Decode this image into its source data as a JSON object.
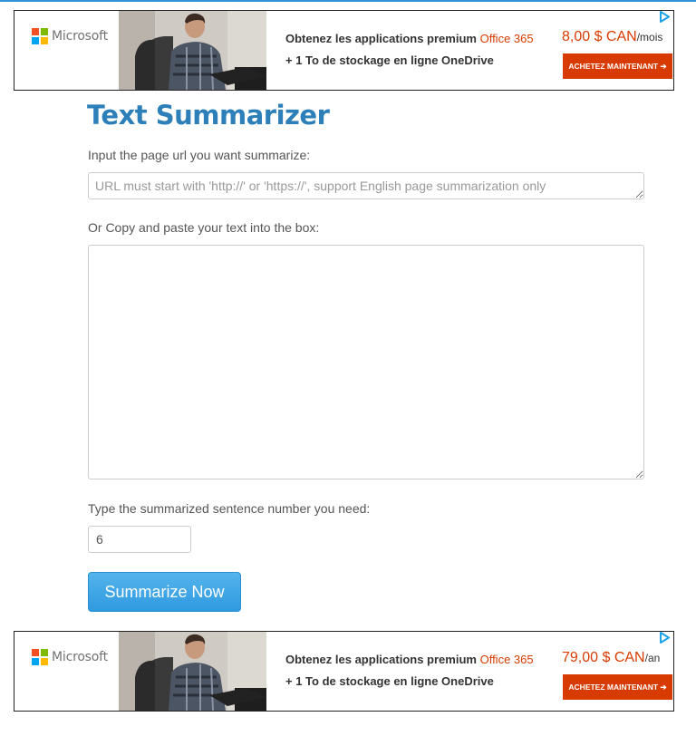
{
  "ads": [
    {
      "brand": "Microsoft",
      "line1_prefix": "Obtenez les applications premium",
      "line1_highlight": "Office 365",
      "line2": "+ 1 To de stockage en ligne OneDrive",
      "price": "8,00 $ CAN",
      "period": "/mois",
      "cta": "ACHETEZ MAINTENANT ➔"
    },
    {
      "brand": "Microsoft",
      "line1_prefix": "Obtenez les applications premium",
      "line1_highlight": "Office 365",
      "line2": "+ 1 To de stockage en ligne OneDrive",
      "price": "79,00 $ CAN",
      "period": "/an",
      "cta": "ACHETEZ MAINTENANT ➔"
    }
  ],
  "form": {
    "title": "Text Summarizer",
    "url_label": "Input the page url you want summarize:",
    "url_placeholder": "URL must start with 'http://' or 'https://', support English page summarization only",
    "url_value": "",
    "text_label": "Or Copy and paste your text into the box:",
    "text_value": "",
    "number_label": "Type the summarized sentence number you need:",
    "number_value": "6",
    "submit_label": "Summarize Now"
  },
  "colors": {
    "title": "#2c7fb8",
    "button": "#3aa3e6",
    "ad_accent": "#d83b01"
  }
}
